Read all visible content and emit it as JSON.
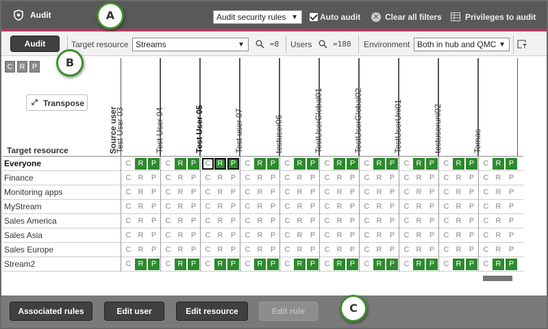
{
  "topbar": {
    "title": "Audit",
    "rules_select": "Audit security rules",
    "auto_audit_label": "Auto audit",
    "clear_filters_label": "Clear all filters",
    "privileges_label": "Privileges to audit"
  },
  "toolbar": {
    "audit_button": "Audit",
    "target_resource_label": "Target resource",
    "target_resource_value": "Streams",
    "target_count": "=8",
    "users_label": "Users",
    "users_count": "=180",
    "environment_label": "Environment",
    "environment_value": "Both in hub and QMC"
  },
  "crp": [
    "C",
    "R",
    "P"
  ],
  "transpose_label": "Transpose",
  "target_resource_header": "Target resource",
  "source_user_header": "Source user",
  "columns": [
    "Test User 03",
    "Test User 04",
    "Test User 05",
    "Test user 07",
    "testuser06",
    "TestUserGlobal01",
    "TestUserGlobal02",
    "TestUserUni01",
    "testuseruni02",
    "Tomas"
  ],
  "selected_column": 2,
  "rows": [
    {
      "label": "Everyone",
      "bold": true,
      "access": [
        [
          0,
          1,
          1
        ],
        [
          0,
          1,
          1
        ],
        [
          0,
          1,
          1
        ],
        [
          0,
          1,
          1
        ],
        [
          0,
          1,
          1
        ],
        [
          0,
          1,
          1
        ],
        [
          0,
          1,
          1
        ],
        [
          0,
          1,
          1
        ],
        [
          0,
          1,
          1
        ],
        [
          0,
          1,
          1
        ]
      ]
    },
    {
      "label": "Finance",
      "bold": false,
      "access": [
        [
          0,
          0,
          0
        ],
        [
          0,
          0,
          0
        ],
        [
          0,
          0,
          0
        ],
        [
          0,
          0,
          0
        ],
        [
          0,
          0,
          0
        ],
        [
          0,
          0,
          0
        ],
        [
          0,
          0,
          0
        ],
        [
          0,
          0,
          0
        ],
        [
          0,
          0,
          0
        ],
        [
          0,
          0,
          0
        ]
      ]
    },
    {
      "label": "Monitoring apps",
      "bold": false,
      "access": [
        [
          0,
          0,
          0
        ],
        [
          0,
          0,
          0
        ],
        [
          0,
          0,
          0
        ],
        [
          0,
          0,
          0
        ],
        [
          0,
          0,
          0
        ],
        [
          0,
          0,
          0
        ],
        [
          0,
          0,
          0
        ],
        [
          0,
          0,
          0
        ],
        [
          0,
          0,
          0
        ],
        [
          0,
          0,
          0
        ]
      ]
    },
    {
      "label": "MyStream",
      "bold": false,
      "access": [
        [
          0,
          0,
          0
        ],
        [
          0,
          0,
          0
        ],
        [
          0,
          0,
          0
        ],
        [
          0,
          0,
          0
        ],
        [
          0,
          0,
          0
        ],
        [
          0,
          0,
          0
        ],
        [
          0,
          0,
          0
        ],
        [
          0,
          0,
          0
        ],
        [
          0,
          0,
          0
        ],
        [
          0,
          0,
          0
        ]
      ]
    },
    {
      "label": "Sales America",
      "bold": false,
      "access": [
        [
          0,
          0,
          0
        ],
        [
          0,
          0,
          0
        ],
        [
          0,
          0,
          0
        ],
        [
          0,
          0,
          0
        ],
        [
          0,
          0,
          0
        ],
        [
          0,
          0,
          0
        ],
        [
          0,
          0,
          0
        ],
        [
          0,
          0,
          0
        ],
        [
          0,
          0,
          0
        ],
        [
          0,
          0,
          0
        ]
      ]
    },
    {
      "label": "Sales Asia",
      "bold": false,
      "access": [
        [
          0,
          0,
          0
        ],
        [
          0,
          0,
          0
        ],
        [
          0,
          0,
          0
        ],
        [
          0,
          0,
          0
        ],
        [
          0,
          0,
          0
        ],
        [
          0,
          0,
          0
        ],
        [
          0,
          0,
          0
        ],
        [
          0,
          0,
          0
        ],
        [
          0,
          0,
          0
        ],
        [
          0,
          0,
          0
        ]
      ]
    },
    {
      "label": "Sales Europe",
      "bold": false,
      "access": [
        [
          0,
          0,
          0
        ],
        [
          0,
          0,
          0
        ],
        [
          0,
          0,
          0
        ],
        [
          0,
          0,
          0
        ],
        [
          0,
          0,
          0
        ],
        [
          0,
          0,
          0
        ],
        [
          0,
          0,
          0
        ],
        [
          0,
          0,
          0
        ],
        [
          0,
          0,
          0
        ],
        [
          0,
          0,
          0
        ]
      ]
    },
    {
      "label": "Stream2",
      "bold": false,
      "access": [
        [
          0,
          1,
          1
        ],
        [
          0,
          1,
          1
        ],
        [
          0,
          1,
          1
        ],
        [
          0,
          1,
          1
        ],
        [
          0,
          1,
          1
        ],
        [
          0,
          1,
          1
        ],
        [
          0,
          1,
          1
        ],
        [
          0,
          1,
          1
        ],
        [
          0,
          1,
          1
        ],
        [
          0,
          1,
          1
        ]
      ]
    }
  ],
  "bottom": {
    "associated_rules": "Associated rules",
    "edit_user": "Edit user",
    "edit_resource": "Edit resource",
    "edit_rule": "Edit rule"
  },
  "callouts": [
    "A",
    "B",
    "C"
  ],
  "colors": {
    "accent": "#b53a63",
    "granted": "#2d8a2d",
    "callout_border": "#3e8f2a"
  }
}
